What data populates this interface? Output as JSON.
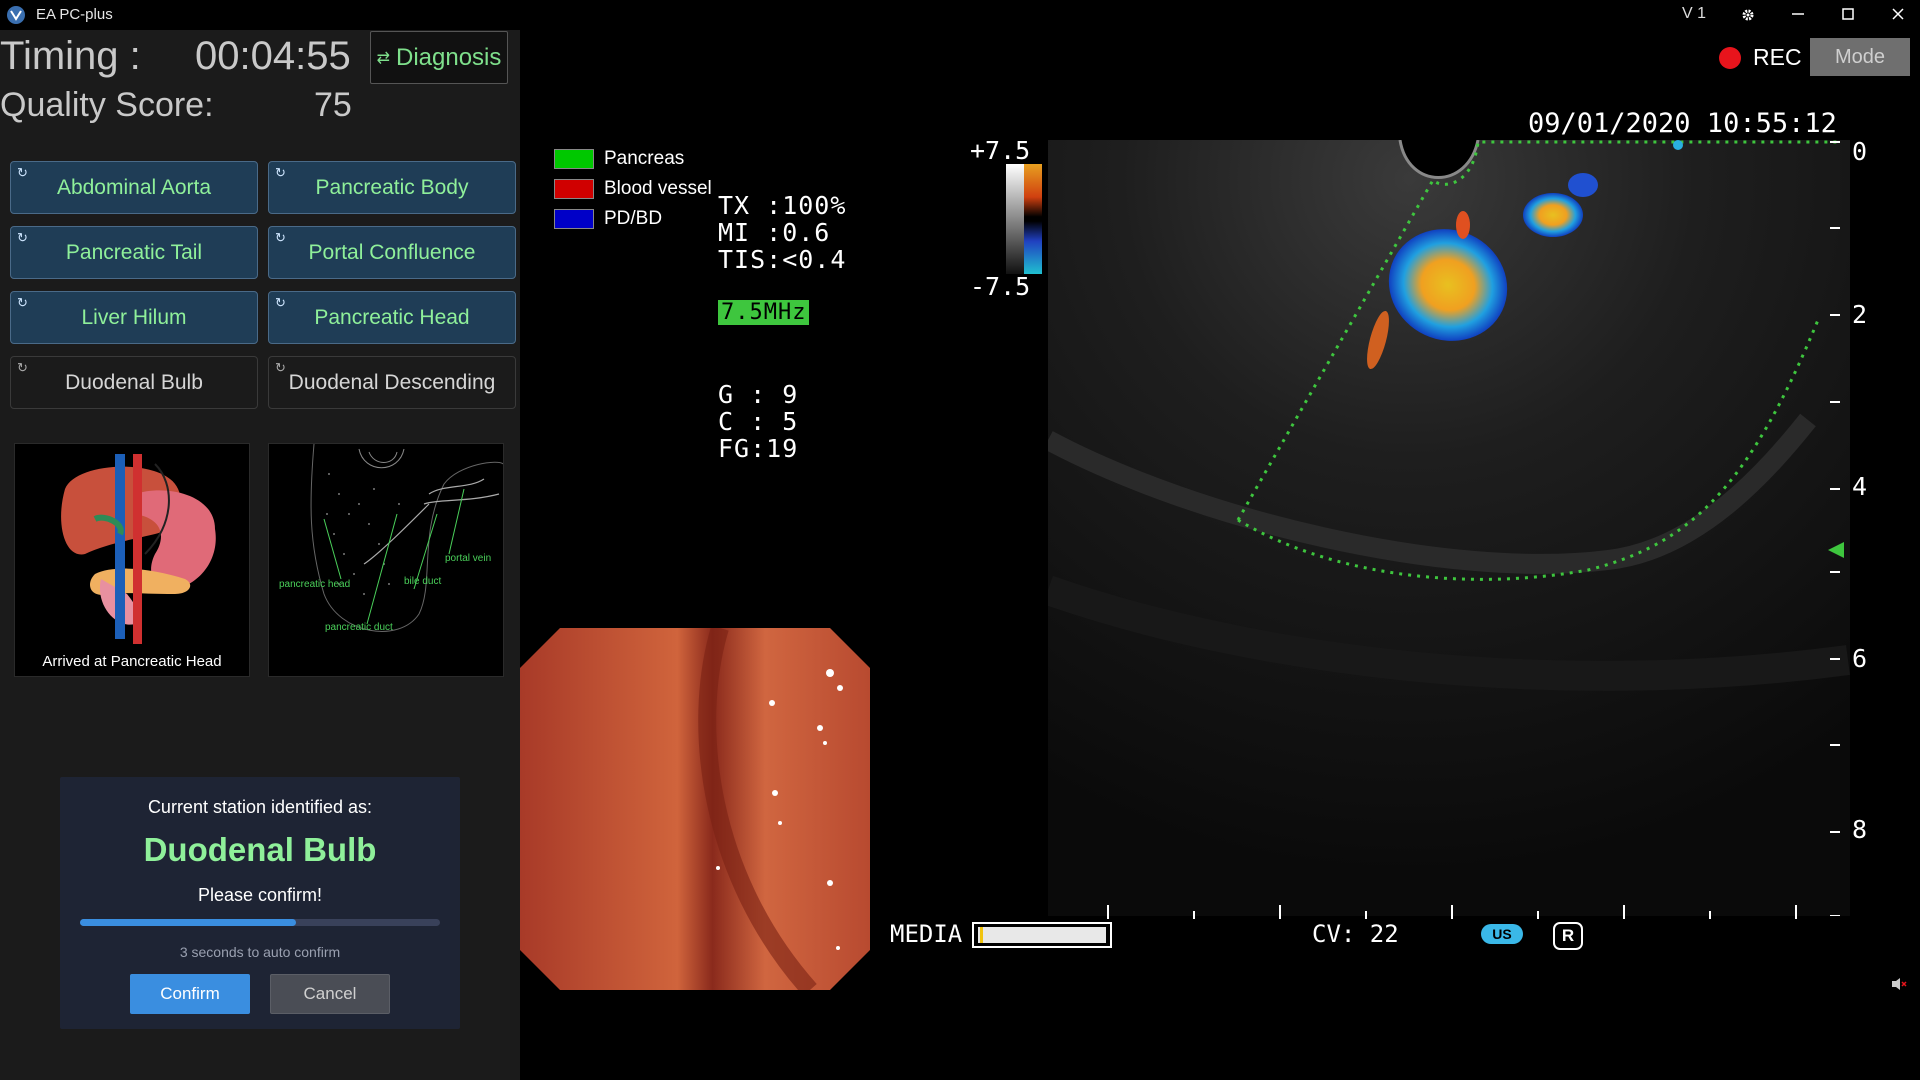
{
  "app": {
    "title": "EA PC-plus",
    "version": "V 1",
    "logo_icon": "app-logo-icon"
  },
  "header": {
    "timing_label": "Timing :",
    "timing_value": "00:04:55",
    "quality_label": "Quality Score:",
    "quality_value": "75",
    "diagnosis_label": "Diagnosis",
    "diagnosis_icon": "swap-arrows-icon"
  },
  "stations": [
    {
      "label": "Abdominal Aorta",
      "active": true
    },
    {
      "label": "Pancreatic Body",
      "active": true
    },
    {
      "label": "Pancreatic Tail",
      "active": true
    },
    {
      "label": "Portal Confluence",
      "active": true
    },
    {
      "label": "Liver Hilum",
      "active": true
    },
    {
      "label": "Pancreatic Head",
      "active": true
    },
    {
      "label": "Duodenal Bulb",
      "active": false
    },
    {
      "label": "Duodenal Descending",
      "active": false
    }
  ],
  "anatomy": {
    "caption": "Arrived at Pancreatic Head",
    "labels": {
      "pancreatic_head": "pancreatic head",
      "bile_duct": "bile duct",
      "portal_vein": "portal vein",
      "pancreatic_duct": "pancreatic duct"
    }
  },
  "dialog": {
    "line1": "Current station identified as:",
    "station": "Duodenal Bulb",
    "prompt": "Please confirm!",
    "progress": 0.6,
    "hint": "3 seconds to auto confirm",
    "confirm_label": "Confirm",
    "cancel_label": "Cancel"
  },
  "legend": [
    {
      "label": "Pancreas",
      "color": "#00c800"
    },
    {
      "label": "Blood vessel",
      "color": "#d00000"
    },
    {
      "label": "PD/BD",
      "color": "#0000c8"
    }
  ],
  "ultrasound": {
    "tx": "TX :100%",
    "mi": "MI :0.6",
    "tis": "TIS:<0.4",
    "frequency": "7.5MHz",
    "g": "G : 9",
    "c": "C : 5",
    "fg": "FG:19",
    "scale_max": "+7.5",
    "scale_min": "-7.5",
    "datetime": "09/01/2020 10:55:12",
    "depth_labels": [
      "0",
      "2",
      "4",
      "6",
      "8"
    ],
    "media_label": "MEDIA",
    "cv_label": "CV: 22",
    "us_badge": "US",
    "r_badge": "R"
  },
  "recording": {
    "rec_label": "REC",
    "mode_label": "Mode"
  },
  "colors": {
    "accent_green": "#8ff09a",
    "button_blue": "#3a8ee0",
    "rec_red": "#e8141c",
    "roi_green": "#3ec63e"
  }
}
